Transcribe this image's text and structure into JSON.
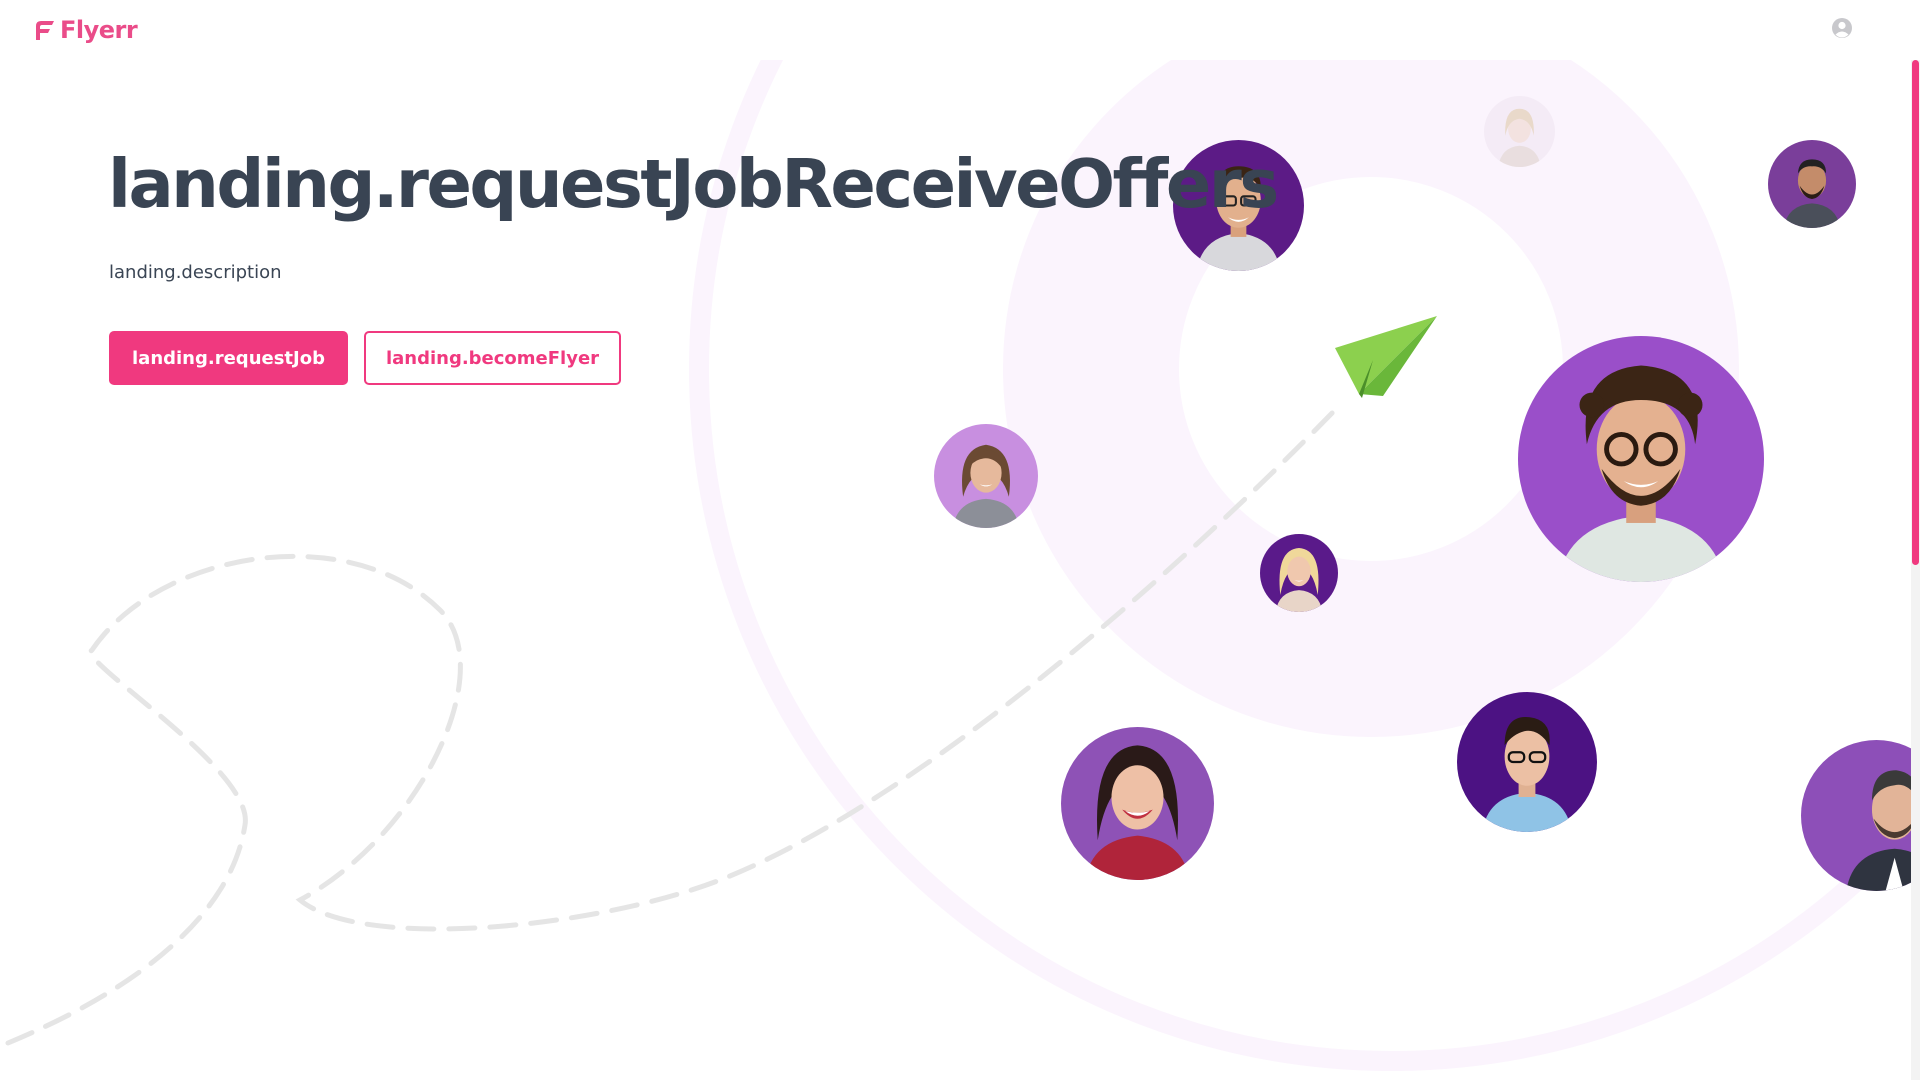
{
  "header": {
    "brand": "Flyerr",
    "brand_color": "#ea4c89",
    "account_icon": "user-circle-icon"
  },
  "hero": {
    "title": "landing.requestJobReceiveOffers",
    "description": "landing.description",
    "primary_button": "landing.requestJob",
    "secondary_button": "landing.becomeFlyer",
    "accent_color": "#f0397f",
    "decoration_icon": "paper-plane-icon"
  }
}
